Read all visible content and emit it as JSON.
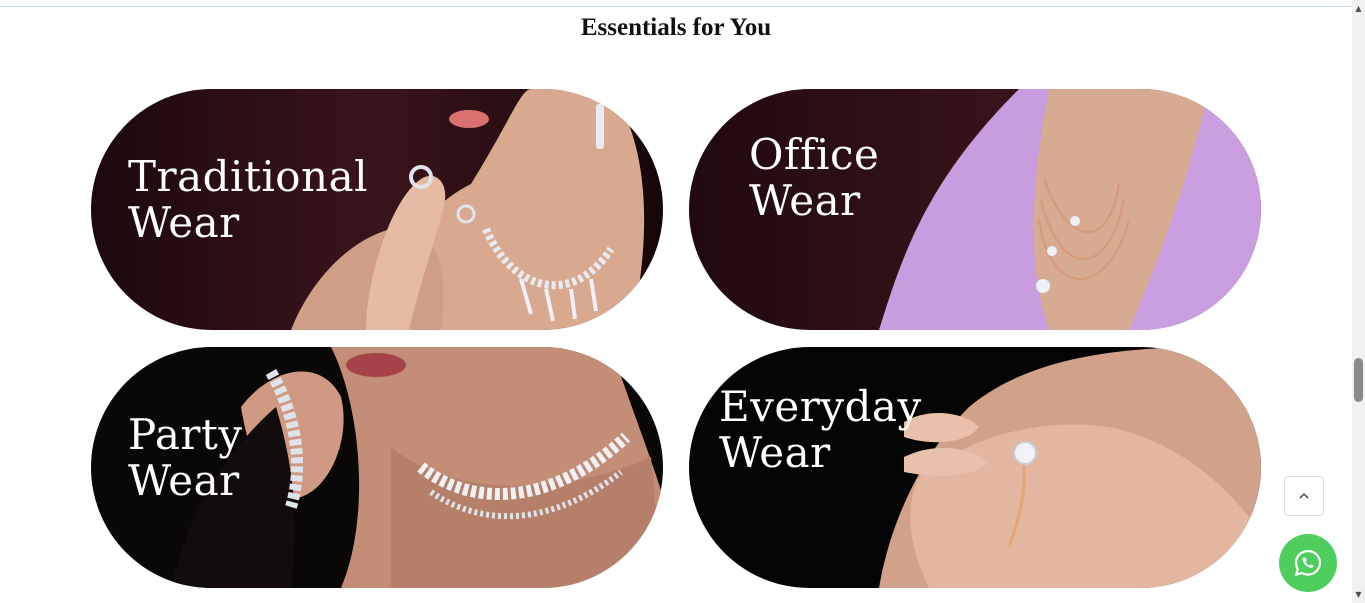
{
  "section": {
    "title": "Essentials for You"
  },
  "cards": [
    {
      "line1": "Traditional",
      "line2": "Wear"
    },
    {
      "line1": "Office",
      "line2": "Wear"
    },
    {
      "line1": "Party",
      "line2": "Wear"
    },
    {
      "line1": "Everyday",
      "line2": "Wear"
    }
  ],
  "icons": {
    "back_to_top": "chevron-up-icon",
    "whatsapp": "whatsapp-icon",
    "scroll_up": "▲",
    "scroll_down": "▼"
  },
  "colors": {
    "whatsapp_green": "#4fce5d",
    "traditional_bg": "#2a0f14",
    "office_bg": "#2b1016",
    "office_blazer": "#c9a0e0",
    "party_bg": "#0a0707",
    "everyday_bg": "#050404",
    "skin": "#e0b49c"
  }
}
